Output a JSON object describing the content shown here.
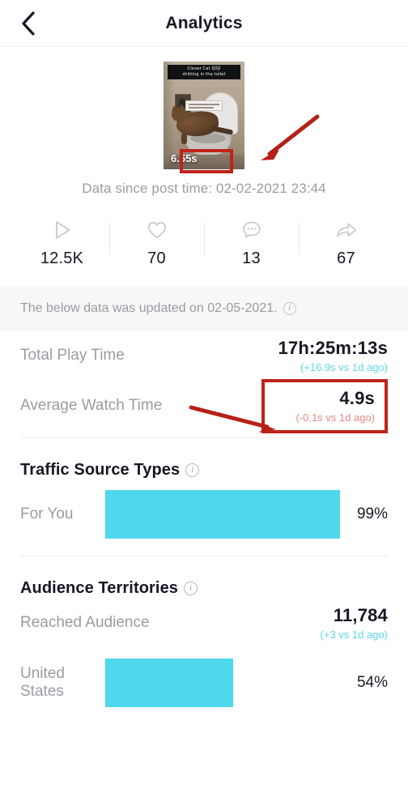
{
  "header": {
    "title": "Analytics",
    "back_icon": "chevron-left-icon"
  },
  "video": {
    "caption_line1": "Clever Cat 🐱🐱",
    "caption_line2": "shitting in the toilet",
    "duration": "6.55s",
    "data_since": "Data since post time: 02-02-2021 23:44"
  },
  "stats": [
    {
      "icon": "play-icon",
      "name": "plays",
      "value": "12.5K"
    },
    {
      "icon": "heart-icon",
      "name": "likes",
      "value": "70"
    },
    {
      "icon": "comment-icon",
      "name": "comments",
      "value": "13"
    },
    {
      "icon": "share-icon",
      "name": "shares",
      "value": "67"
    }
  ],
  "updated_banner": {
    "text": "The below data was updated on 02-05-2021.",
    "info_icon": "info-icon"
  },
  "metrics": [
    {
      "label": "Total Play Time",
      "value": "17h:25m:13s",
      "delta": "(+16.9s vs 1d ago)",
      "delta_direction": "up",
      "highlighted": false
    },
    {
      "label": "Average Watch Time",
      "value": "4.9s",
      "delta": "(-0.1s vs 1d ago)",
      "delta_direction": "down",
      "highlighted": true
    }
  ],
  "traffic_section": {
    "title": "Traffic Source Types",
    "info_icon": "info-icon"
  },
  "audience_section": {
    "title": "Audience Territories",
    "info_icon": "info-icon",
    "reached_label": "Reached Audience",
    "reached_value": "11,784",
    "reached_delta": "(+3 vs 1d ago)"
  },
  "colors": {
    "bar": "#4FD8EC",
    "delta_up": "#5FD8E8",
    "delta_down": "#E08B80",
    "annotation_red": "#BF2319",
    "text_primary": "#161823",
    "text_muted": "#9B9BA3",
    "banner_bg": "#F7F7F8"
  },
  "chart_data": [
    {
      "type": "bar",
      "title": "Traffic Source Types",
      "categories": [
        "For You"
      ],
      "values": [
        99
      ],
      "value_labels": [
        "99%"
      ],
      "xlabel": "",
      "ylabel": "",
      "xlim": [
        0,
        100
      ],
      "orientation": "horizontal",
      "grid": false,
      "legend": "none"
    },
    {
      "type": "bar",
      "title": "Audience Territories",
      "categories": [
        "United States"
      ],
      "values": [
        54
      ],
      "value_labels": [
        "54%"
      ],
      "xlabel": "",
      "ylabel": "",
      "xlim": [
        0,
        100
      ],
      "orientation": "horizontal",
      "grid": false,
      "legend": "none"
    }
  ]
}
